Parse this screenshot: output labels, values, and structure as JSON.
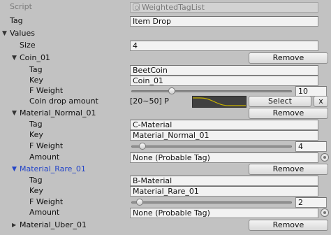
{
  "inspector": {
    "script_label": "Script",
    "script_value": "WeightedTagList",
    "tag_label": "Tag",
    "tag_value": "Item Drop",
    "values_label": "Values",
    "size_label": "Size",
    "size_value": "4",
    "remove_label": "Remove",
    "items": [
      {
        "name": "Coin_01",
        "tag_label": "Tag",
        "tag_value": "BeetCoin",
        "key_label": "Key",
        "key_value": "Coin_01",
        "weight_label": "F Weight",
        "weight_value": "10",
        "weight_fraction": 0.24,
        "amount_label": "Coin drop amount",
        "amount_range": "[20~50] P",
        "select_label": "Select",
        "x_label": "x"
      },
      {
        "name": "Material_Normal_01",
        "tag_label": "Tag",
        "tag_value": "C-Material",
        "key_label": "Key",
        "key_value": "Material_Normal_01",
        "weight_label": "F Weight",
        "weight_value": "4",
        "weight_fraction": 0.05,
        "amount_label": "Amount",
        "amount_value": "None (Probable Tag)"
      },
      {
        "name": "Material_Rare_01",
        "tag_label": "Tag",
        "tag_value": "B-Material",
        "key_label": "Key",
        "key_value": "Material_Rare_01",
        "weight_label": "F Weight",
        "weight_value": "2",
        "weight_fraction": 0.03,
        "amount_label": "Amount",
        "amount_value": "None (Probable Tag)"
      },
      {
        "name": "Material_Uber_01"
      }
    ]
  },
  "colors": {
    "panel": "#c2c2c2",
    "selected_text": "#2445c8",
    "curve_bg": "#404040",
    "curve_line": "#c9b400"
  }
}
